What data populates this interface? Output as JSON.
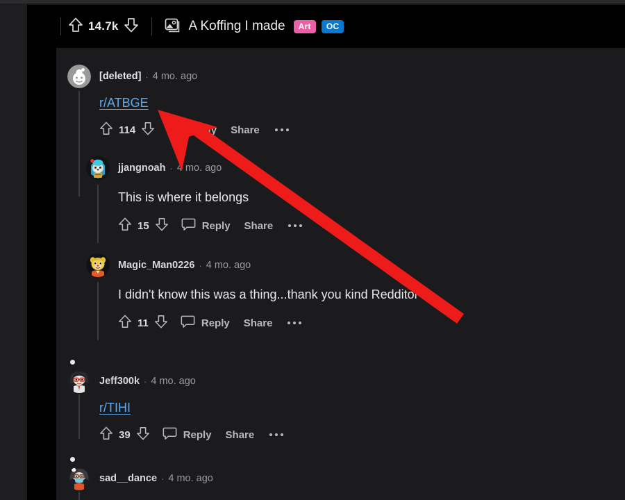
{
  "post": {
    "score": "14.7k",
    "upvote_icon": "upvote-arrow-icon",
    "downvote_icon": "downvote-arrow-icon",
    "thumbnail_icon": "image-thumbnail-icon",
    "title": "A Koffing I made",
    "badges": [
      {
        "label": "Art",
        "color": "#ec5ea8"
      },
      {
        "label": "OC",
        "color": "#0b78d0"
      }
    ]
  },
  "actions": {
    "reply_label": "Reply",
    "share_label": "Share",
    "more_icon": "ellipsis-icon",
    "comment_icon": "speech-bubble-icon"
  },
  "comments": [
    {
      "author": "[deleted]",
      "age": "4 mo. ago",
      "separator": "·",
      "link_text": "r/ATBGE",
      "body": "",
      "score": "114",
      "avatar": "snoo-deleted-avatar"
    },
    {
      "author": "jjangnoah",
      "age": "4 mo. ago",
      "separator": "·",
      "link_text": "",
      "body": "This is where it belongs",
      "score": "15",
      "avatar": "teal-hat-avatar"
    },
    {
      "author": "Magic_Man0226",
      "age": "4 mo. ago",
      "separator": "·",
      "link_text": "",
      "body": "I didn't know this was a thing...thank you kind Redditor",
      "score": "11",
      "avatar": "yellow-bear-avatar"
    },
    {
      "author": "Jeff300k",
      "age": "4 mo. ago",
      "separator": "·",
      "link_text": "r/TIHI",
      "body": "",
      "score": "39",
      "avatar": "dark-hair-avatar"
    },
    {
      "author": "sad__dance",
      "age": "4 mo. ago",
      "separator": "·",
      "link_text": "",
      "body": "",
      "score": "",
      "avatar": "mask-avatar"
    }
  ],
  "annotation": {
    "arrow_color": "#ee1b1b",
    "arrow_name": "red-pointer-arrow"
  }
}
